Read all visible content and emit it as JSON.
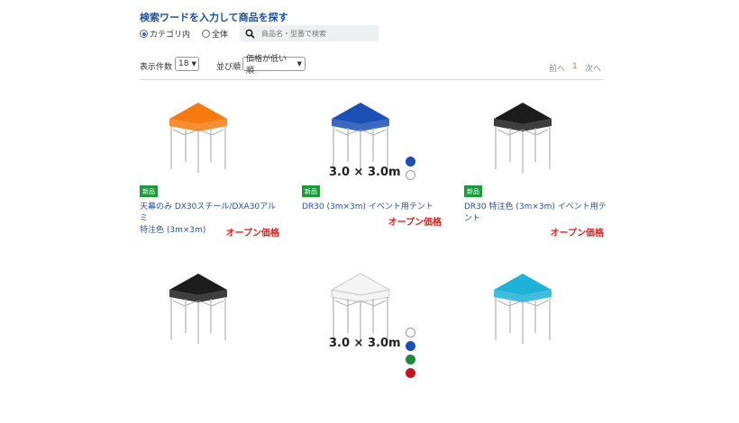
{
  "search": {
    "title": "検索ワードを入力して商品を探す",
    "scope_in_category": "カテゴリ内",
    "scope_all": "全体",
    "placeholder": "商品名・型番で検索",
    "selected_scope": "カテゴリ内"
  },
  "toolbar": {
    "per_page_label": "表示件数",
    "per_page_value": "18",
    "sort_label": "並び順",
    "sort_value": "価格が低い順"
  },
  "pager": {
    "prev": "前へ",
    "current": "1",
    "next": "次へ"
  },
  "products": [
    {
      "tent_color": "#f57a10",
      "badge": "新品",
      "name_line1": "天幕のみ DX30スチール/DXA30アルミ",
      "name_line2": "特注色 (3m×3m)",
      "price": "オープン価格"
    },
    {
      "tent_color": "#1a4fb5",
      "size_label": "3.0 × 3.0m",
      "swatches": [
        "#1a4fb5",
        "#ffffff"
      ],
      "badge": "新品",
      "name_line1": "DR30 (3m×3m) イベント用テント",
      "name_line2": "",
      "price": "オープン価格"
    },
    {
      "tent_color": "#1c1c1c",
      "badge": "新品",
      "name_line1": "DR30 特注色 (3m×3m) イベント用テ",
      "name_line2": "ント",
      "price": "オープン価格"
    },
    {
      "tent_color": "#1c1c1c"
    },
    {
      "tent_color": "#f4f4f4",
      "size_label": "3.0 × 3.0m",
      "swatches": [
        "#ffffff",
        "#1a4fb5",
        "#1e8a3a",
        "#c0171c"
      ]
    },
    {
      "tent_color": "#1fb2d8"
    }
  ],
  "colors": {
    "accent_blue": "#1f4f9c",
    "price_red": "#e1211f",
    "badge_green": "#1e9a3a",
    "pager_current": "#e06a10"
  }
}
